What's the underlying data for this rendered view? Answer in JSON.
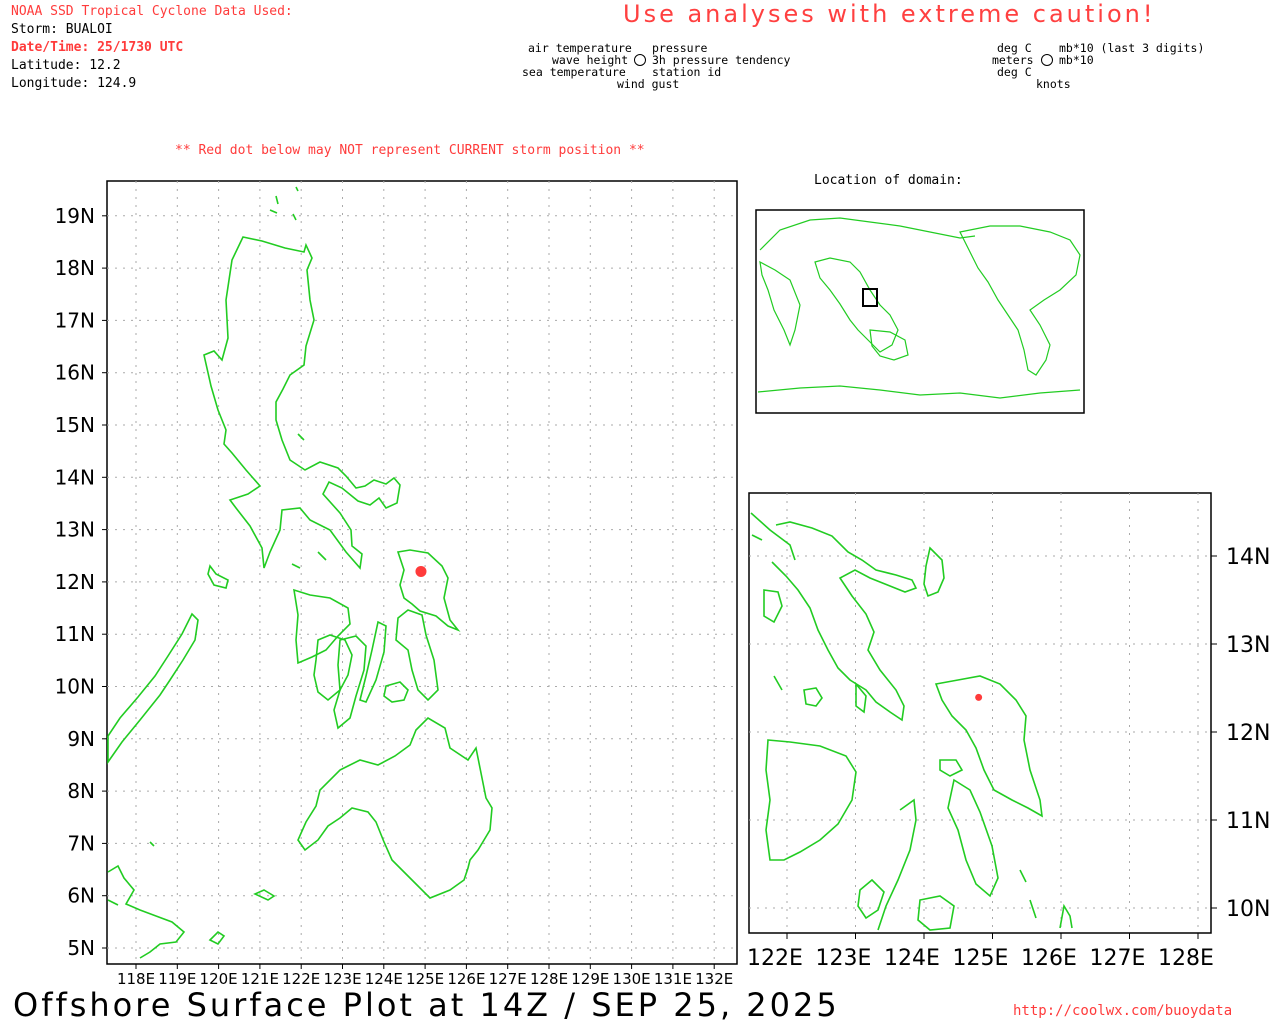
{
  "header": {
    "source": "NOAA SSD Tropical Cyclone Data Used:",
    "storm": "Storm: BUALOI",
    "datetime": "Date/Time: 25/1730 UTC",
    "latitude": "Latitude: 12.2",
    "longitude": "Longitude: 124.9",
    "caution": "Use analyses with extreme caution!"
  },
  "legend": {
    "left_top_left": "air temperature",
    "left_top_right": "pressure",
    "left_mid_left": "wave height",
    "left_mid_right": "3h pressure tendency",
    "left_bot_left": "sea temperature",
    "left_bot_right": "station id",
    "left_bottom": "wind gust",
    "right_top_left": "deg C",
    "right_top_right": "mb*10 (last 3 digits)",
    "right_mid_left": "meters",
    "right_mid_right": "mb*10",
    "right_bot_left": "deg C",
    "right_bottom": "knots"
  },
  "notice": "** Red dot below may NOT represent CURRENT storm position **",
  "inset_title": "Location of domain:",
  "storm_position": {
    "lat": 12.2,
    "lon": 124.9,
    "color": "#ff3b3b"
  },
  "main_map": {
    "lat_labels": [
      "5N",
      "6N",
      "7N",
      "8N",
      "9N",
      "10N",
      "11N",
      "12N",
      "13N",
      "14N",
      "15N",
      "16N",
      "17N",
      "18N",
      "19N"
    ],
    "lon_labels": [
      "118E",
      "119E",
      "120E",
      "121E",
      "122E",
      "123E",
      "124E",
      "125E",
      "126E",
      "127E",
      "128E",
      "129E",
      "130E",
      "131E",
      "132E"
    ]
  },
  "zoom_map": {
    "lat_labels": [
      "10N",
      "11N",
      "12N",
      "13N",
      "14N"
    ],
    "lon_labels": [
      "122E",
      "123E",
      "124E",
      "125E",
      "126E",
      "127E",
      "128E"
    ]
  },
  "colors": {
    "coastline": "#22cc22",
    "storm": "#ff3b3b",
    "grid": "#aaaaaa"
  },
  "footer": {
    "title": "Offshore Surface Plot at 14Z / SEP 25, 2025",
    "url": "http://coolwx.com/buoydata"
  }
}
